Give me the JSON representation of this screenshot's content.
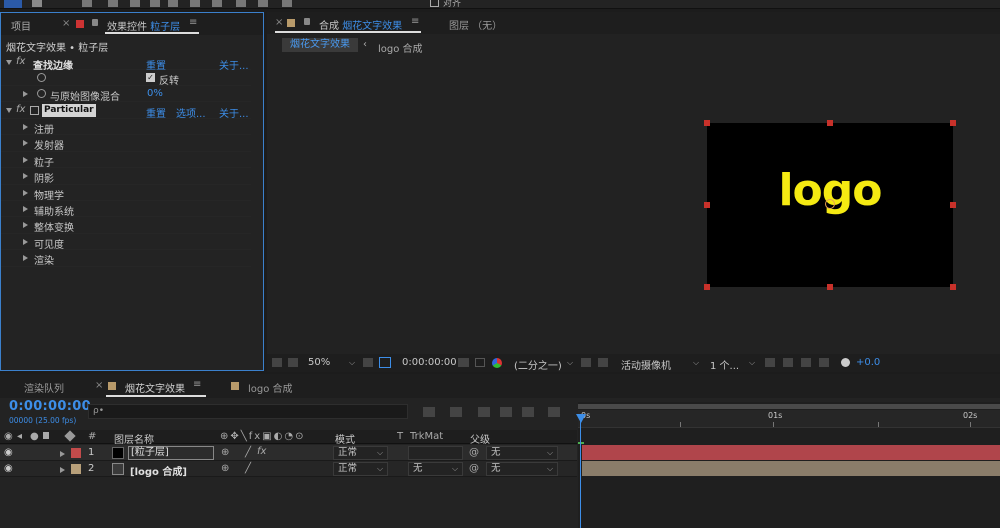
{
  "top_toolbar": {
    "align_label": "对齐"
  },
  "left_panel": {
    "tab_project": "项目",
    "tab_effects_prefix": "效果控件",
    "tab_effects_layer": "粒子层",
    "breadcrumb": "烟花文字效果 • 粒子层",
    "effects": [
      {
        "name": "查找边缘",
        "reset": "重置",
        "about": "关于..."
      },
      {
        "name": "Particular",
        "reset": "重置",
        "options": "选项...",
        "about": "关于..."
      }
    ],
    "find_edges": {
      "invert_label": "反转",
      "blend_label": "与原始图像混合",
      "blend_value": "0%"
    },
    "particular_groups": [
      "注册",
      "发射器",
      "粒子",
      "阴影",
      "物理学",
      "辅助系统",
      "整体变换",
      "可见度",
      "渲染"
    ]
  },
  "comp_panel": {
    "tab_label": "合成",
    "tab_comp_name": "烟花文字效果",
    "layer_tab": "图层 （无）",
    "sub_tabs": [
      "烟花文字效果",
      "logo 合成"
    ],
    "logo_text": "logo",
    "bottom_bar": {
      "zoom": "50%",
      "timecode": "0:00:00:00",
      "resolution": "(二分之一)",
      "camera": "活动摄像机",
      "views": "1 个...",
      "exposure": "+0.0"
    },
    "colors": {
      "logo": "#f5ea12",
      "handles": "#c8312a",
      "canvas": "#000000"
    }
  },
  "timeline": {
    "tab_render": "渲染队列",
    "tab_comp": "烟花文字效果",
    "tab_logo": "logo 合成",
    "timecode": "0:00:00:00",
    "fps": "00000 (25.00 fps)",
    "search_placeholder": "ρ•",
    "headers": {
      "num": "#",
      "name": "图层名称",
      "mode": "模式",
      "t": "T",
      "trkmat": "TrkMat",
      "parent": "父级"
    },
    "ruler": [
      "0s",
      "01s",
      "02s"
    ],
    "layers": [
      {
        "num": "1",
        "name": "[粒子层]",
        "mode": "正常",
        "trkmat": "",
        "parent": "无",
        "label_color": "#c34b4b",
        "bar_color": "#b0454b"
      },
      {
        "num": "2",
        "name": "[logo 合成]",
        "mode": "正常",
        "trkmat": "无",
        "parent": "无",
        "label_color": "#b8a07a",
        "bar_color": "#8a7d6a"
      }
    ]
  }
}
